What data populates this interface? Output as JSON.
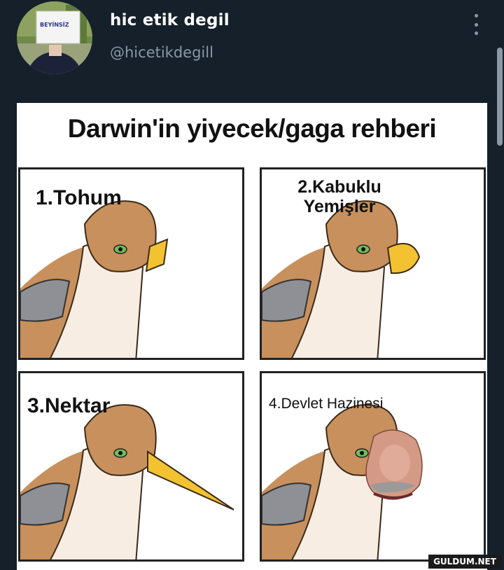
{
  "tweet": {
    "display_name": "hic etik degil",
    "handle": "@hicetikdegill",
    "avatar_icon": "avatar",
    "more_icon": "more-vertical-icon",
    "avatar_sign_text": "BEYİNSİZ"
  },
  "meme": {
    "title": "Darwin'in yiyecek/gaga rehberi",
    "panels": [
      {
        "label": "1.Tohum"
      },
      {
        "label": "2.Kabuklu Yemişler"
      },
      {
        "label": "3.Nektar"
      },
      {
        "label": "4.Devlet Hazinesi"
      }
    ],
    "watermark": "GULDUM.NET"
  },
  "colors": {
    "background": "#15202b",
    "text_primary": "#ffffff",
    "text_secondary": "#8899a6",
    "bird_head": "#c8905c",
    "bird_beak": "#f2c230"
  }
}
